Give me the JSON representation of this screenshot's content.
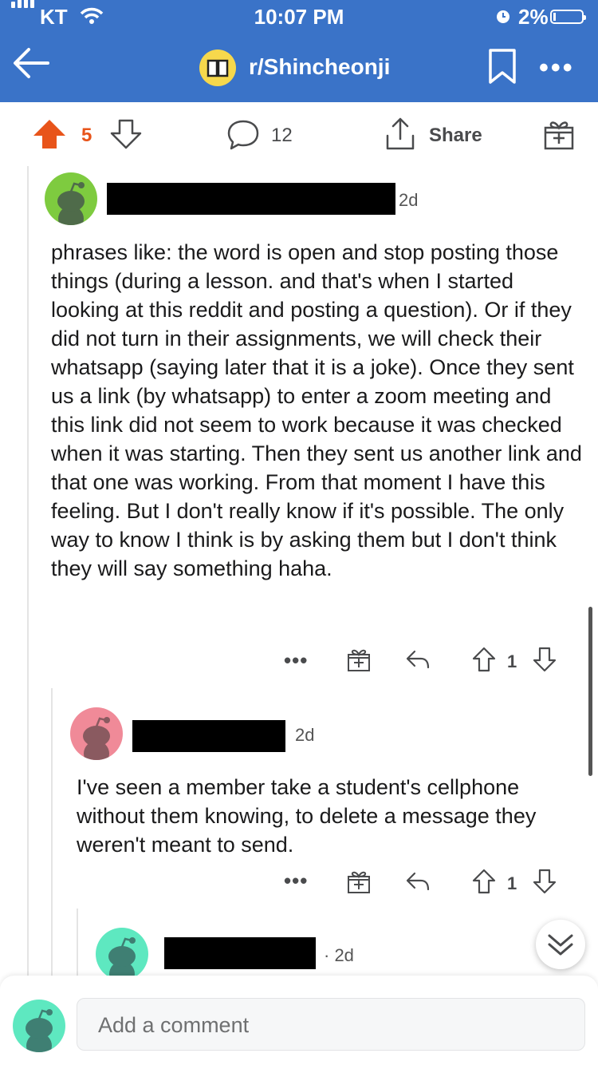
{
  "status": {
    "carrier": "KT",
    "time": "10:07 PM",
    "battery": "2%"
  },
  "header": {
    "subreddit": "r/Shincheonji"
  },
  "post_actions": {
    "vote_count": "5",
    "comment_count": "12",
    "share_label": "Share"
  },
  "comments": [
    {
      "age": "2d",
      "body": "phrases like: the word is open and stop posting those things (during a lesson. and that's when I started looking at this reddit and posting a question). Or if they did not turn in their assignments, we will check their whatsapp (saying later that it is a joke). Once they sent us a link (by whatsapp) to enter a zoom meeting and this link did not seem to work because it was checked when it was starting. Then they sent us another link and that one was working. From that moment I have this feeling. But I don't really know if it's possible. The only way to know I think is by asking them but I don't think they will say something haha.",
      "score": "1",
      "avatar_color": "#7ecb3f"
    },
    {
      "age": "2d",
      "body": "I've seen a member take a student's cellphone without them knowing, to delete a message they weren't meant to send.",
      "score": "1",
      "avatar_color": "#f08a98"
    },
    {
      "age": "· 2d",
      "avatar_color": "#5ee8c0"
    }
  ],
  "composer": {
    "placeholder": "Add a comment",
    "avatar_color": "#5ee8c0"
  },
  "colors": {
    "header_bg": "#3a73c8",
    "upvote": "#e8541a"
  }
}
